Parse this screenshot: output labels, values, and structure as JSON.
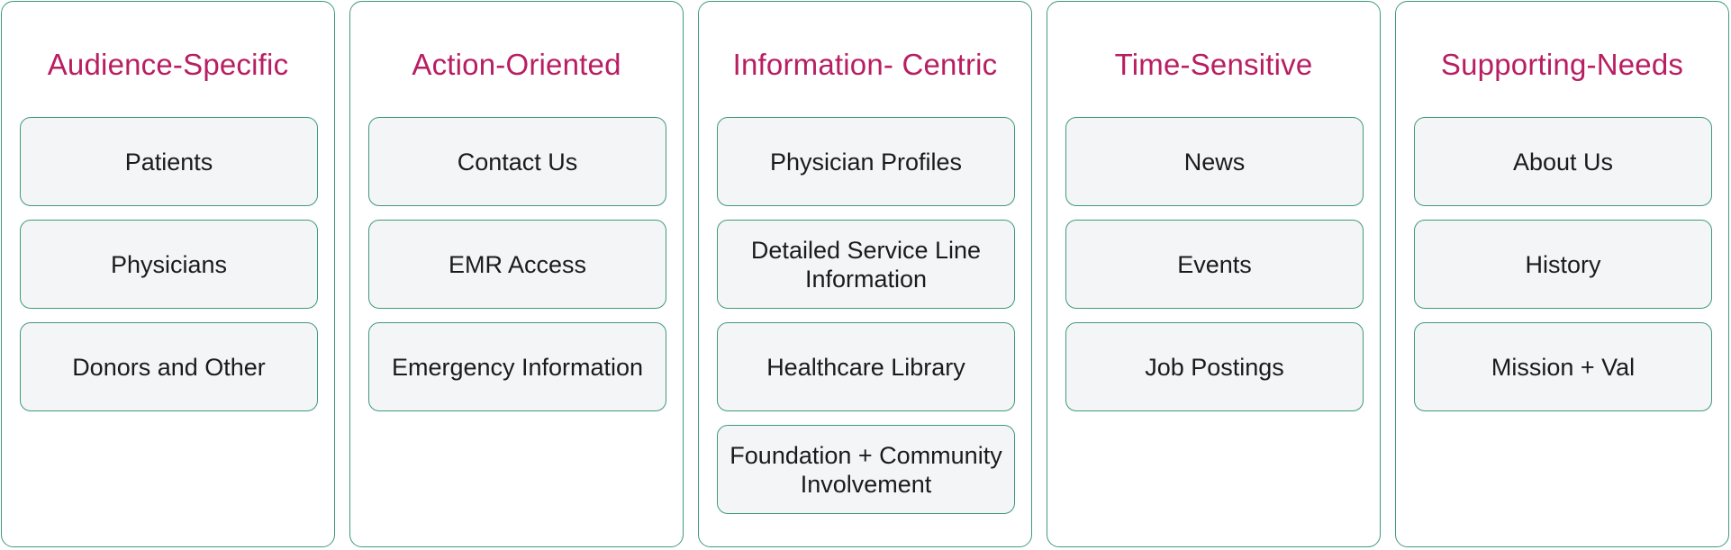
{
  "colors": {
    "heading": "#b81e62",
    "border": "#3f9a7c",
    "card_background": "#f4f5f7",
    "text": "#1b1b1b"
  },
  "columns": [
    {
      "title": "Audience-Specific",
      "items": [
        "Patients",
        "Physicians",
        "Donors and Other"
      ]
    },
    {
      "title": "Action-Oriented",
      "items": [
        "Contact Us",
        "EMR Access",
        "Emergency Information"
      ]
    },
    {
      "title": "Information- Centric",
      "items": [
        "Physician Profiles",
        "Detailed Service Line\nInformation",
        "Healthcare Library",
        "Foundation + Community\nInvolvement"
      ]
    },
    {
      "title": "Time-Sensitive",
      "items": [
        "News",
        "Events",
        "Job Postings"
      ]
    },
    {
      "title": "Supporting-Needs",
      "items": [
        "About Us",
        "History",
        "Mission + Val"
      ]
    }
  ]
}
